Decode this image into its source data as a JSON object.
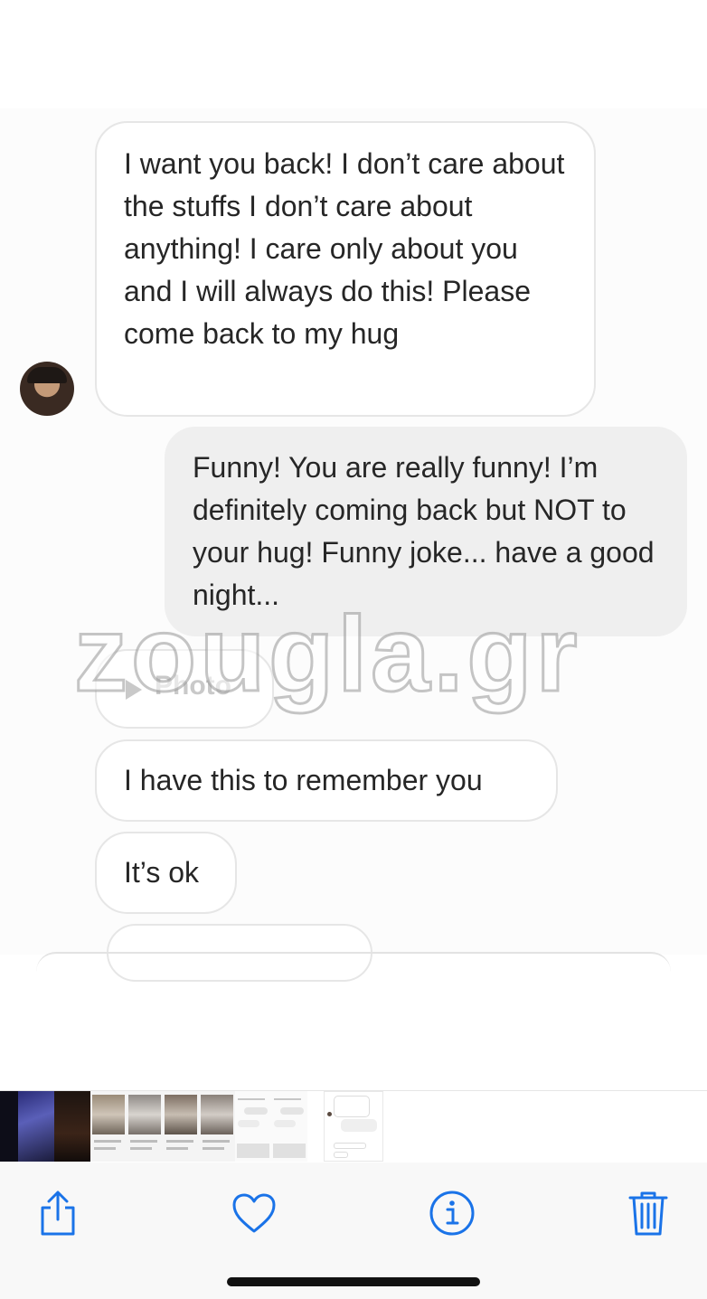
{
  "messages": [
    {
      "side": "incoming",
      "text": "I want you back! I don’t care about the stuffs I don’t care about anything! I care only about you and I will always do this! Please come back to my hug"
    },
    {
      "side": "outgoing",
      "text": "Funny! You are really funny! I’m definitely coming back but NOT to your hug! Funny joke... have a good night..."
    },
    {
      "side": "incoming",
      "type": "attachment",
      "text": "Photo"
    },
    {
      "side": "incoming",
      "text": "I have this to remember you"
    },
    {
      "side": "incoming",
      "text": "It’s ok"
    }
  ],
  "watermark": "zougla.gr",
  "toolbar": {
    "share_icon": "share-icon",
    "favorite_icon": "heart-icon",
    "info_icon": "info-icon",
    "delete_icon": "trash-icon",
    "accent_color": "#1a73e8"
  },
  "colors": {
    "incoming_bubble": "#ffffff",
    "outgoing_bubble": "#efefef",
    "bubble_border": "#e6e6e6",
    "text": "#262626"
  }
}
